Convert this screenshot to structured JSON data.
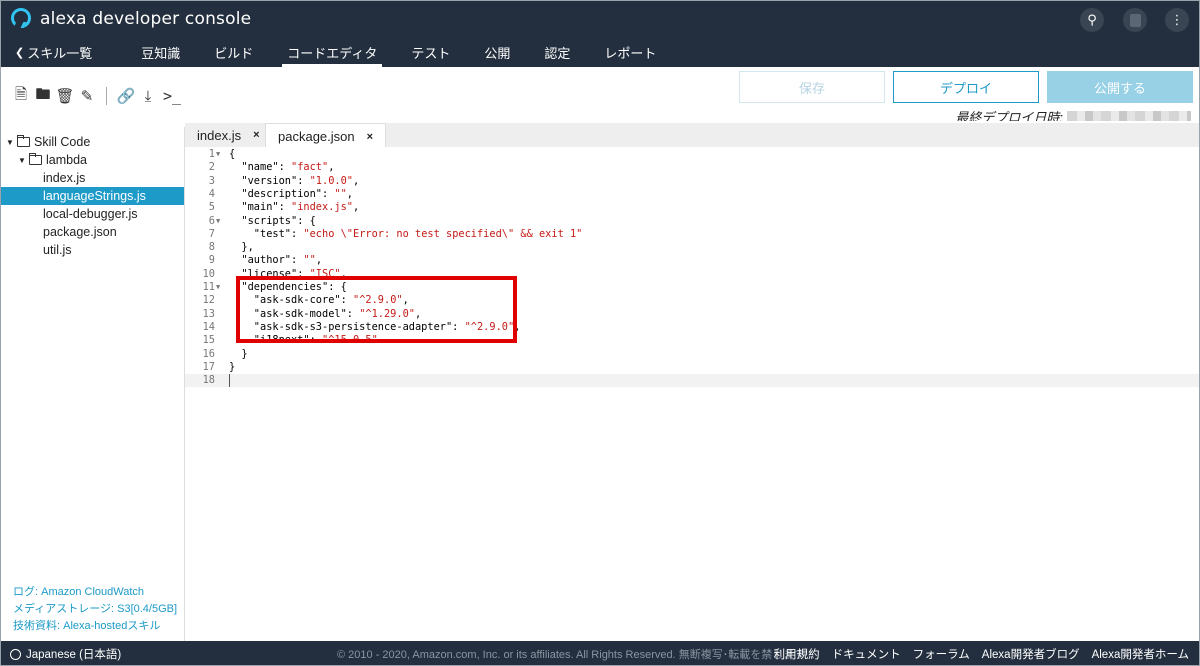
{
  "header": {
    "app_title": "alexa developer console",
    "nav": [
      "スキル一覧",
      "豆知識",
      "ビルド",
      "コードエディタ",
      "テスト",
      "公開",
      "認定",
      "レポート"
    ],
    "nav_back_glyph": "❮",
    "active_nav": "コードエディタ",
    "icons": [
      "search-icon",
      "account-icon",
      "more-vertical-icon"
    ]
  },
  "toolbar": {
    "save_label": "保存",
    "deploy_label": "デプロイ",
    "publish_label": "公開する",
    "last_deploy_label": "最終デプロイ日時:",
    "icons": [
      "new-file-icon",
      "new-folder-icon",
      "delete-icon",
      "rename-icon",
      "link-icon",
      "download-icon",
      "terminal-icon"
    ]
  },
  "sidebar": {
    "tree": [
      {
        "label": "Skill Code",
        "depth": 0,
        "type": "folder"
      },
      {
        "label": "lambda",
        "depth": 1,
        "type": "folder"
      },
      {
        "label": "index.js",
        "depth": 2,
        "type": "file"
      },
      {
        "label": "languageStrings.js",
        "depth": 2,
        "type": "file",
        "selected": true
      },
      {
        "label": "local-debugger.js",
        "depth": 2,
        "type": "file"
      },
      {
        "label": "package.json",
        "depth": 2,
        "type": "file"
      },
      {
        "label": "util.js",
        "depth": 2,
        "type": "file"
      }
    ],
    "links": [
      "ログ: Amazon CloudWatch",
      "メディアストレージ: S3[0.4/5GB]",
      "技術資料: Alexa-hostedスキル"
    ]
  },
  "editor": {
    "tabs": [
      {
        "label": "index.js",
        "close": "×"
      },
      {
        "label": "package.json",
        "close": "×",
        "active": true
      }
    ],
    "lines": [
      {
        "n": "1",
        "fold": true,
        "parts": [
          [
            "p",
            "{"
          ]
        ]
      },
      {
        "n": "2",
        "parts": [
          [
            "p",
            "  \"name\": "
          ],
          [
            "s",
            "\"fact\""
          ],
          [
            "p",
            ","
          ]
        ]
      },
      {
        "n": "3",
        "parts": [
          [
            "p",
            "  \"version\": "
          ],
          [
            "s",
            "\"1.0.0\""
          ],
          [
            "p",
            ","
          ]
        ]
      },
      {
        "n": "4",
        "parts": [
          [
            "p",
            "  \"description\": "
          ],
          [
            "s",
            "\"\""
          ],
          [
            "p",
            ","
          ]
        ]
      },
      {
        "n": "5",
        "parts": [
          [
            "p",
            "  \"main\": "
          ],
          [
            "s",
            "\"index.js\""
          ],
          [
            "p",
            ","
          ]
        ]
      },
      {
        "n": "6",
        "fold": true,
        "parts": [
          [
            "p",
            "  \"scripts\": {"
          ]
        ]
      },
      {
        "n": "7",
        "parts": [
          [
            "p",
            "    \"test\": "
          ],
          [
            "s",
            "\"echo \\\"Error: no test specified\\\" && exit 1\""
          ]
        ]
      },
      {
        "n": "8",
        "parts": [
          [
            "p",
            "  },"
          ]
        ]
      },
      {
        "n": "9",
        "parts": [
          [
            "p",
            "  \"author\": "
          ],
          [
            "s",
            "\"\""
          ],
          [
            "p",
            ","
          ]
        ]
      },
      {
        "n": "10",
        "parts": [
          [
            "p",
            "  \"license\": "
          ],
          [
            "s",
            "\"ISC\""
          ],
          [
            "p",
            ","
          ]
        ]
      },
      {
        "n": "11",
        "fold": true,
        "parts": [
          [
            "p",
            "  \"dependencies\": {"
          ]
        ]
      },
      {
        "n": "12",
        "parts": [
          [
            "p",
            "    \"ask-sdk-core\": "
          ],
          [
            "s",
            "\"^2.9.0\""
          ],
          [
            "p",
            ","
          ]
        ]
      },
      {
        "n": "13",
        "parts": [
          [
            "p",
            "    \"ask-sdk-model\": "
          ],
          [
            "s",
            "\"^1.29.0\""
          ],
          [
            "p",
            ","
          ]
        ]
      },
      {
        "n": "14",
        "parts": [
          [
            "p",
            "    \"ask-sdk-s3-persistence-adapter\": "
          ],
          [
            "s",
            "\"^2.9.0\""
          ],
          [
            "p",
            ","
          ]
        ]
      },
      {
        "n": "15",
        "parts": [
          [
            "p",
            "    \"i18next\": "
          ],
          [
            "s",
            "\"^15.0.5\""
          ]
        ]
      },
      {
        "n": "16",
        "parts": [
          [
            "p",
            "  }"
          ]
        ]
      },
      {
        "n": "17",
        "parts": [
          [
            "p",
            "}"
          ]
        ]
      },
      {
        "n": "18",
        "current": true,
        "parts": []
      }
    ]
  },
  "footer": {
    "language": "Japanese (日本語)",
    "copyright": "© 2010 - 2020, Amazon.com, Inc. or its affiliates. All Rights Reserved. 無断複写･転載を禁じます",
    "links": [
      "利用規約",
      "ドキュメント",
      "フォーラム",
      "Alexa開発者ブログ",
      "Alexa開発者ホーム"
    ]
  },
  "colors": {
    "header_bg": "#232f3e",
    "accent": "#1d9ac7",
    "string": "#c41a16",
    "annotation": "#e00000"
  }
}
